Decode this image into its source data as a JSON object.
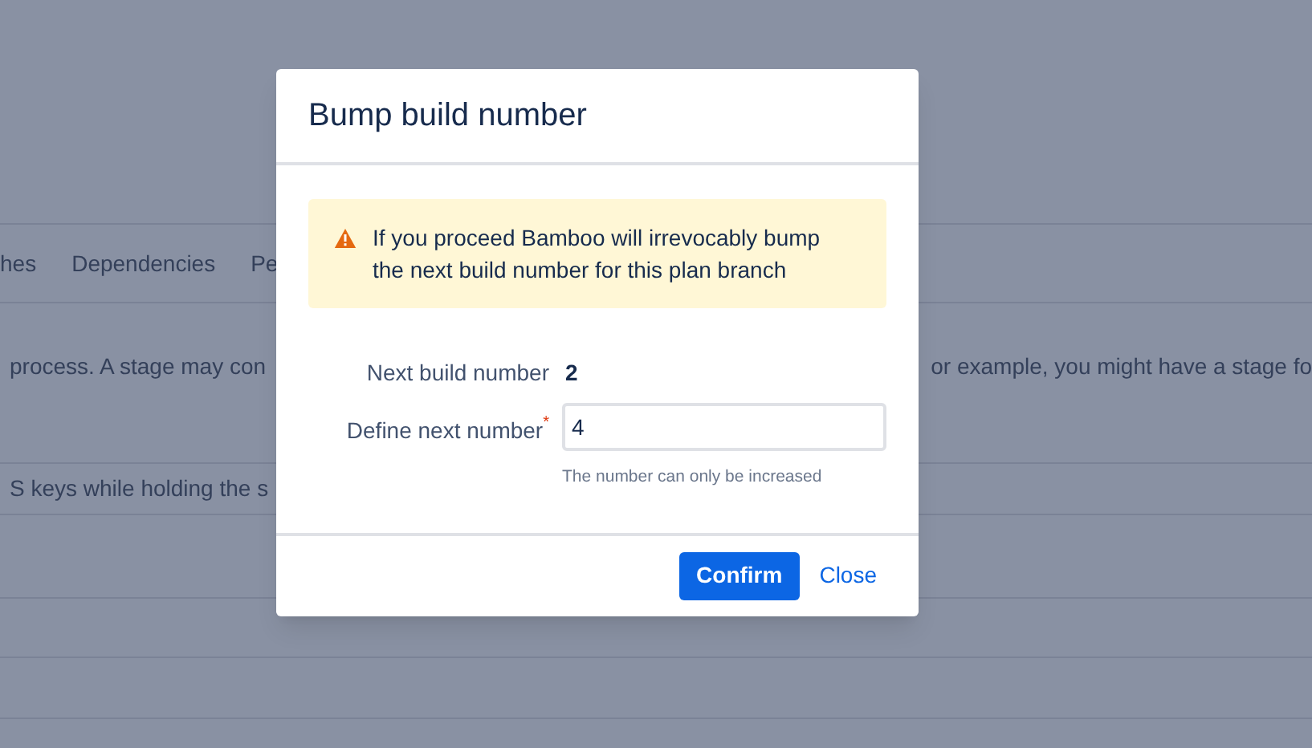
{
  "background": {
    "tabs": [
      "hes",
      "Dependencies",
      "Pe"
    ],
    "description_left": "process. A stage may con",
    "description_right": "or example, you might have a stage fo",
    "hint": "S keys while holding the s"
  },
  "dialog": {
    "title": "Bump build number",
    "warning": {
      "kind": "warning",
      "text": "If you proceed Bamboo will irrevocably bump the next build number for this plan branch"
    },
    "fields": [
      {
        "kind": "readonly",
        "label": "Next build number",
        "value": "2"
      },
      {
        "kind": "input",
        "label": "Define next number",
        "value": "4",
        "required_mark": "*",
        "help": "The number can only be increased"
      }
    ],
    "buttons": [
      {
        "kind": "primary",
        "label": "Confirm"
      },
      {
        "kind": "link",
        "label": "Close"
      }
    ]
  }
}
